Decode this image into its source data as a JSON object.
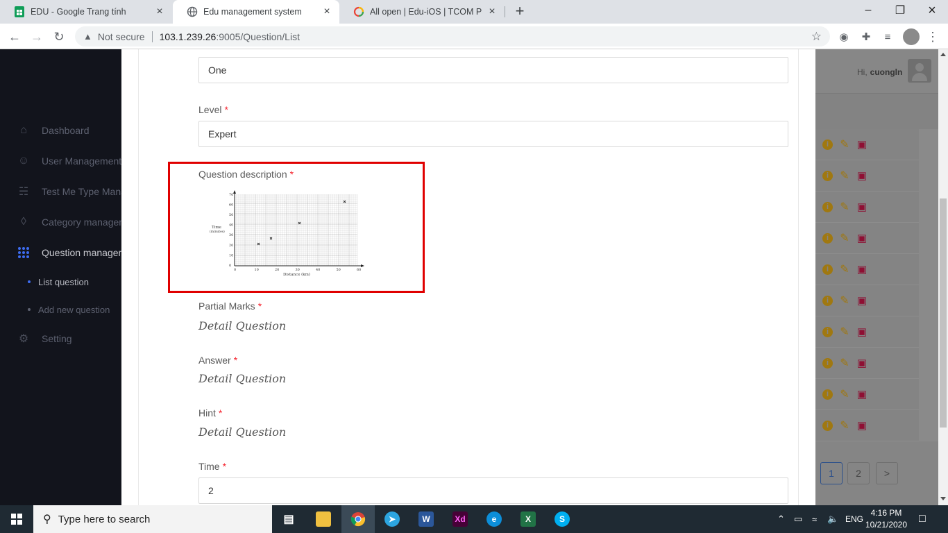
{
  "browser": {
    "tabs": [
      {
        "title": "EDU - Google Trang tính",
        "icon": "sheets-icon"
      },
      {
        "title": "Edu management system",
        "icon": "globe-icon",
        "active": true
      },
      {
        "title": "All open | Edu-iOS | TCOM Projec",
        "icon": "loop-icon"
      }
    ],
    "security_label": "Not secure",
    "url_host": "103.1.239.26",
    "url_path": ":9005/Question/List"
  },
  "sidebar": {
    "items": [
      {
        "label": "Dashboard",
        "icon": "home-icon"
      },
      {
        "label": "User Management",
        "icon": "user-icon"
      },
      {
        "label": "Test Me Type Mana",
        "icon": "bank-icon"
      },
      {
        "label": "Category managem",
        "icon": "layers-icon"
      },
      {
        "label": "Question manageme",
        "icon": "grid-icon",
        "active": true
      }
    ],
    "subitems": [
      {
        "label": "List question",
        "active": true
      },
      {
        "label": "Add new question"
      }
    ],
    "setting": {
      "label": "Setting",
      "icon": "gear-icon"
    }
  },
  "form": {
    "fields": {
      "first_value": "One",
      "level_label": "Level",
      "level_value": "Expert",
      "question_description_label": "Question description",
      "partial_marks_label": "Partial Marks",
      "partial_marks_value": "Detail Question",
      "answer_label": "Answer",
      "answer_value": "Detail Question",
      "hint_label": "Hint",
      "hint_value": "Detail Question",
      "time_label": "Time",
      "time_value": "2"
    },
    "required_mark": "*"
  },
  "question_image": {
    "ylabel": "Time",
    "ylabel_unit": "(minutes)",
    "xlabel": "Distance (km)",
    "y_ticks": [
      "0",
      "10",
      "20",
      "30",
      "40",
      "50",
      "60",
      "70"
    ],
    "x_ticks": [
      "0",
      "10",
      "20",
      "30",
      "40",
      "50",
      "60"
    ]
  },
  "background_app": {
    "greeting": "Hi,",
    "username": "cuongln",
    "row_count": 10,
    "pages": [
      "1",
      "2"
    ],
    "next_glyph": ">"
  },
  "taskbar": {
    "search_placeholder": "Type here to search",
    "language": "ENG",
    "time": "4:16 PM",
    "date": "10/21/2020"
  },
  "colors": {
    "sidebar_bg": "#12141c",
    "accent": "#3d6cf0",
    "required": "#f5222d",
    "highlight_border": "#e00000"
  }
}
